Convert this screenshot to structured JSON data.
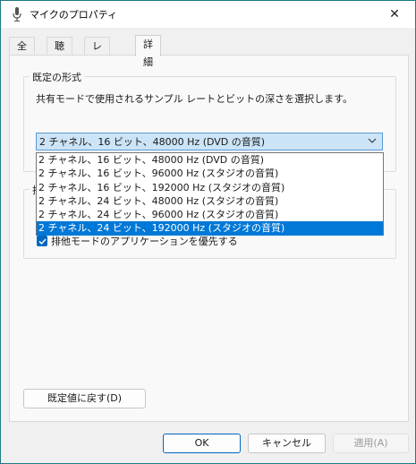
{
  "window": {
    "title": "マイクのプロパティ",
    "close_glyph": "✕"
  },
  "tabs": [
    {
      "label": "全般"
    },
    {
      "label": "聴く"
    },
    {
      "label": "レベル"
    },
    {
      "label": "詳細"
    }
  ],
  "default_format": {
    "group_title": "既定の形式",
    "description": "共有モードで使用されるサンプル レートとビットの深さを選択します。",
    "selected": "2 チャネル、16 ビット、48000 Hz (DVD の音質)",
    "options": [
      "2 チャネル、16 ビット、48000 Hz (DVD の音質)",
      "2 チャネル、16 ビット、96000 Hz (スタジオの音質)",
      "2 チャネル、16 ビット、192000 Hz (スタジオの音質)",
      "2 チャネル、24 ビット、48000 Hz (スタジオの音質)",
      "2 チャネル、24 ビット、96000 Hz (スタジオの音質)",
      "2 チャネル、24 ビット、192000 Hz (スタジオの音質)"
    ],
    "highlighted_index": 5
  },
  "exclusive": {
    "group_title_partial": "排",
    "checkbox_label": "排他モードのアプリケーションを優先する"
  },
  "buttons": {
    "restore_default": "既定値に戻す(D)",
    "ok": "OK",
    "cancel": "キャンセル",
    "apply": "適用(A)"
  },
  "colors": {
    "accent": "#0067c0",
    "selection": "#0078d7",
    "combo_fill": "#cce4f7"
  }
}
